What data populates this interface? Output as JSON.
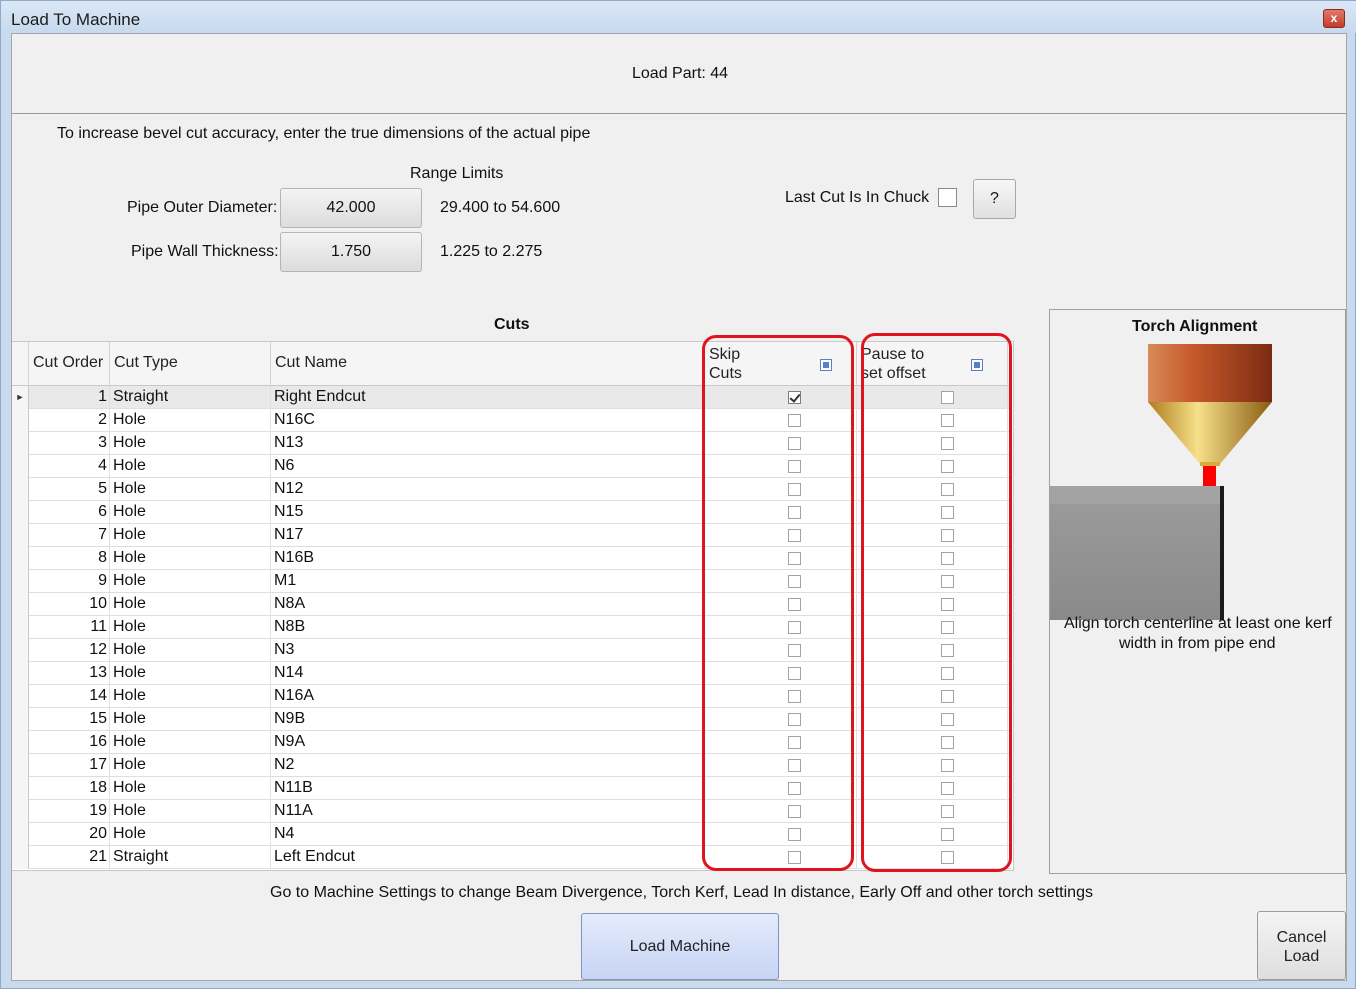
{
  "window": {
    "title": "Load To Machine",
    "close_label": "x"
  },
  "header": {
    "load_part": "Load Part: 44"
  },
  "dimensions": {
    "instruction": "To increase bevel cut accuracy, enter the true dimensions of the actual pipe",
    "range_limits_label": "Range Limits",
    "outer_diameter": {
      "label": "Pipe Outer Diameter:",
      "value": "42.000",
      "range": "29.400 to 54.600"
    },
    "wall_thickness": {
      "label": "Pipe Wall Thickness:",
      "value": "1.750",
      "range": "1.225 to 2.275"
    },
    "last_cut_in_chuck": {
      "label": "Last Cut Is In Chuck",
      "checked": false
    },
    "help_label": "?"
  },
  "cuts": {
    "title": "Cuts",
    "columns": {
      "order": "Cut Order",
      "type": "Cut Type",
      "name": "Cut Name",
      "skip_line1": "Skip",
      "skip_line2": "Cuts",
      "pause_line1": "Pause to",
      "pause_line2": "set offset"
    },
    "rows": [
      {
        "order": "1",
        "type": "Straight",
        "name": "Right Endcut",
        "skip": true,
        "pause": false
      },
      {
        "order": "2",
        "type": "Hole",
        "name": "N16C",
        "skip": false,
        "pause": false
      },
      {
        "order": "3",
        "type": "Hole",
        "name": "N13",
        "skip": false,
        "pause": false
      },
      {
        "order": "4",
        "type": "Hole",
        "name": "N6",
        "skip": false,
        "pause": false
      },
      {
        "order": "5",
        "type": "Hole",
        "name": "N12",
        "skip": false,
        "pause": false
      },
      {
        "order": "6",
        "type": "Hole",
        "name": "N15",
        "skip": false,
        "pause": false
      },
      {
        "order": "7",
        "type": "Hole",
        "name": "N17",
        "skip": false,
        "pause": false
      },
      {
        "order": "8",
        "type": "Hole",
        "name": "N16B",
        "skip": false,
        "pause": false
      },
      {
        "order": "9",
        "type": "Hole",
        "name": "M1",
        "skip": false,
        "pause": false
      },
      {
        "order": "10",
        "type": "Hole",
        "name": "N8A",
        "skip": false,
        "pause": false
      },
      {
        "order": "11",
        "type": "Hole",
        "name": "N8B",
        "skip": false,
        "pause": false
      },
      {
        "order": "12",
        "type": "Hole",
        "name": "N3",
        "skip": false,
        "pause": false
      },
      {
        "order": "13",
        "type": "Hole",
        "name": "N14",
        "skip": false,
        "pause": false
      },
      {
        "order": "14",
        "type": "Hole",
        "name": "N16A",
        "skip": false,
        "pause": false
      },
      {
        "order": "15",
        "type": "Hole",
        "name": "N9B",
        "skip": false,
        "pause": false
      },
      {
        "order": "16",
        "type": "Hole",
        "name": "N9A",
        "skip": false,
        "pause": false
      },
      {
        "order": "17",
        "type": "Hole",
        "name": "N2",
        "skip": false,
        "pause": false
      },
      {
        "order": "18",
        "type": "Hole",
        "name": "N11B",
        "skip": false,
        "pause": false
      },
      {
        "order": "19",
        "type": "Hole",
        "name": "N11A",
        "skip": false,
        "pause": false
      },
      {
        "order": "20",
        "type": "Hole",
        "name": "N4",
        "skip": false,
        "pause": false
      },
      {
        "order": "21",
        "type": "Straight",
        "name": "Left Endcut",
        "skip": false,
        "pause": false
      }
    ]
  },
  "torch": {
    "title": "Torch Alignment",
    "caption_line1": "Align torch centerline at least one kerf",
    "caption_line2": "width in from pipe end"
  },
  "footer": {
    "note": "Go to Machine Settings to change Beam Divergence, Torch Kerf, Lead In distance, Early Off and other torch settings",
    "load_button": "Load Machine",
    "cancel_line1": "Cancel",
    "cancel_line2": "Load"
  },
  "colors": {
    "highlight_box": "#e0141e",
    "title_bar": "#c9daee",
    "torch_body": "#c0502a",
    "nozzle": "#d9b23a",
    "beam": "#ff0000",
    "pipe": "#8c8c8c"
  }
}
